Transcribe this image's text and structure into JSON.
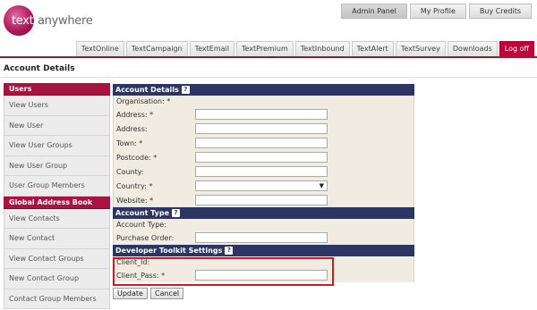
{
  "brand": {
    "text_a": "text",
    "text_b": "anywhere"
  },
  "topnav": [
    "Admin Panel",
    "My Profile",
    "Buy Credits"
  ],
  "tabs": [
    "TextOnline",
    "TextCampaign",
    "TextEmail",
    "TextPremium",
    "TextInbound",
    "TextAlert",
    "TextSurvey",
    "Downloads",
    "Log off"
  ],
  "page_title": "Account Details",
  "sidebar": {
    "users_header": "Users",
    "users_items": [
      "View Users",
      "New User",
      "View User Groups",
      "New User Group",
      "User Group Members"
    ],
    "gab_header": "Global Address Book",
    "gab_items": [
      "View Contacts",
      "New Contact",
      "View Contact Groups",
      "New Contact Group",
      "Contact Group Members"
    ]
  },
  "account_details": {
    "title": "Account Details",
    "help": "?",
    "organisation_label": "Organisation: *",
    "fields": [
      "Address: *",
      "Address:",
      "Town: *",
      "Postcode: *",
      "County:",
      "Country: *",
      "Website: *"
    ]
  },
  "account_type": {
    "title": "Account Type",
    "help": "?",
    "type_label": "Account Type:",
    "po_label": "Purchase Order:"
  },
  "developer": {
    "title": "Developer Toolkit Settings",
    "help": "?",
    "client_id_label": "Client_Id:",
    "client_pass_label": "Client_Pass: *"
  },
  "actions": {
    "update": "Update",
    "cancel": "Cancel"
  },
  "colors": {
    "brand": "#a8133f",
    "section": "#2d3663",
    "highlight": "#e0141e"
  }
}
